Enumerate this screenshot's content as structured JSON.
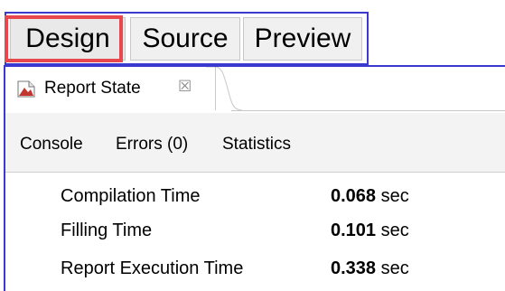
{
  "editor_tabs": [
    {
      "label": "Design",
      "selected": true
    },
    {
      "label": "Source",
      "selected": false
    },
    {
      "label": "Preview",
      "selected": false
    }
  ],
  "view": {
    "icon": "report-icon",
    "title": "Report State",
    "close_symbol": "☒"
  },
  "sub_tabs": [
    {
      "label": "Console"
    },
    {
      "label": "Errors (0)"
    },
    {
      "label": "Statistics"
    }
  ],
  "stats": [
    {
      "label": "Compilation Time",
      "value": "0.068",
      "unit": "sec"
    },
    {
      "label": "Filling Time",
      "value": "0.101",
      "unit": "sec"
    },
    {
      "label": "Report Execution Time",
      "value": "0.338",
      "unit": "sec"
    }
  ],
  "colors": {
    "highlight": "#e8474d",
    "frame_border": "#3a3ad0"
  }
}
